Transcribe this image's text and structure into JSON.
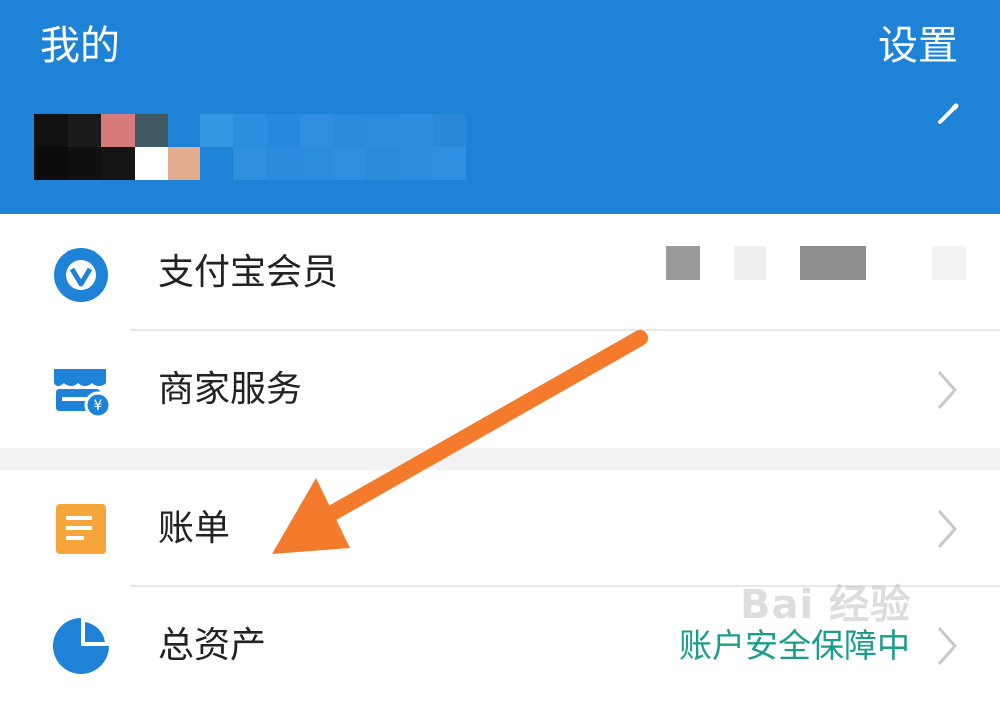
{
  "header": {
    "title": "我的",
    "settings_label": "设置",
    "edit_icon": "edit-pencil-icon",
    "background_color": "#1e83d6"
  },
  "menu": [
    {
      "label": "支付宝会员",
      "icon": "member-badge-icon",
      "right": "pixelated-redacted"
    },
    {
      "label": "商家服务",
      "icon": "merchant-store-icon",
      "right": "chevron-right-icon"
    },
    {
      "label": "账单",
      "icon": "bill-document-icon",
      "right": "chevron-right-icon"
    },
    {
      "label": "总资产",
      "icon": "pie-chart-icon",
      "status": "账户安全保障中",
      "right": "chevron-right-icon"
    }
  ],
  "watermark": "Bai 经验",
  "colors": {
    "brand_blue": "#1e83d6",
    "bill_orange": "#f5a53a",
    "status_teal": "#1a9e8a",
    "annotation_arrow": "#f47a2c"
  }
}
